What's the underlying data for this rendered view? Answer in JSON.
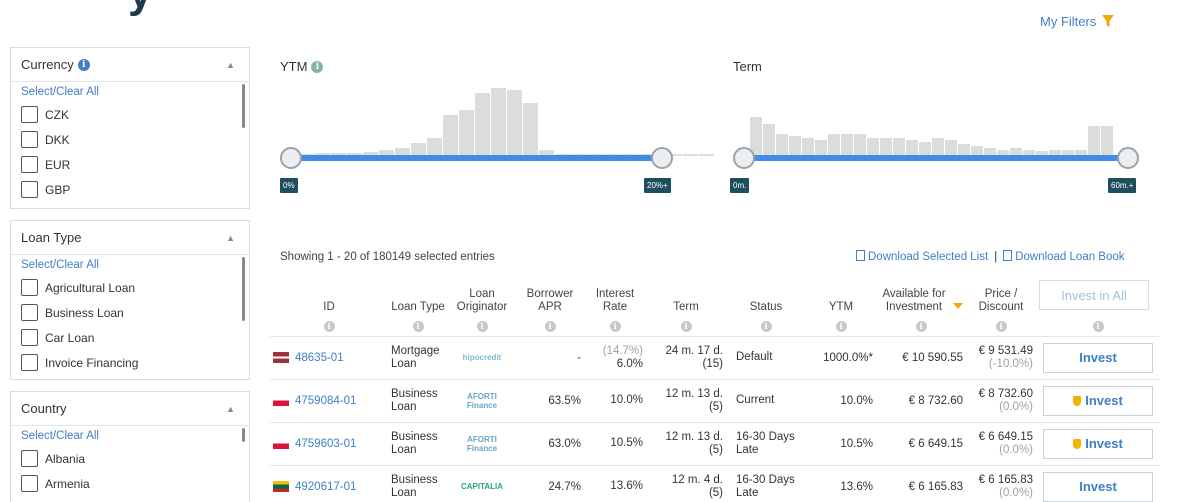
{
  "header": {
    "title_fragment": "y",
    "my_filters_label": "My Filters",
    "filter_icon": "funnel-icon",
    "accent": "#3f7fc4",
    "filter_icon_color": "#f2a900"
  },
  "sidebar": {
    "currency": {
      "title": "Currency",
      "select_all": "Select/Clear All",
      "options": [
        "CZK",
        "DKK",
        "EUR",
        "GBP"
      ]
    },
    "loan_type": {
      "title": "Loan Type",
      "select_all": "Select/Clear All",
      "options": [
        "Agricultural Loan",
        "Business Loan",
        "Car Loan",
        "Invoice Financing"
      ]
    },
    "country": {
      "title": "Country",
      "select_all": "Select/Clear All",
      "options": [
        "Albania",
        "Armenia"
      ]
    }
  },
  "sliders": {
    "ytm": {
      "label": "YTM",
      "min_tag": "0%",
      "max_tag": "20%+"
    },
    "term": {
      "label": "Term",
      "min_tag": "0m.",
      "max_tag": "60m.+"
    }
  },
  "results": {
    "showing": "Showing 1 - 20 of 180149 selected entries",
    "download_selected": "Download Selected List",
    "separator": "|",
    "download_book": "Download Loan Book",
    "invest_all": "Invest in All"
  },
  "table": {
    "headers": {
      "id": "ID",
      "loan_type": "Loan Type",
      "originator": "Loan Originator",
      "apr": "Borrower APR",
      "rate": "Interest Rate",
      "term": "Term",
      "status": "Status",
      "ytm": "YTM",
      "available": "Available for Investment",
      "price": "Price / Discount"
    },
    "rows": [
      {
        "flag": "latvia",
        "id": "48635-01",
        "loan_type": "Mortgage Loan",
        "originator": "hipocredit",
        "apr": "-",
        "rate_top": "(14.7%)",
        "rate_bottom": "6.0%",
        "term_top": "24 m. 17 d.",
        "term_bottom": "(15)",
        "status": "Default",
        "ytm": "1000.0%*",
        "available": "€ 10 590.55",
        "price": "€ 9 531.49",
        "discount": "(-10.0%)",
        "invest": "Invest",
        "shield": false
      },
      {
        "flag": "poland",
        "id": "4759084-01",
        "loan_type": "Business Loan",
        "originator": "AFORTI Finance",
        "apr": "63.5%",
        "rate_top": "",
        "rate_bottom": "10.0%",
        "term_top": "12 m. 13 d.",
        "term_bottom": "(5)",
        "status": "Current",
        "ytm": "10.0%",
        "available": "€ 8 732.60",
        "price": "€ 8 732.60",
        "discount": "(0.0%)",
        "invest": "Invest",
        "shield": true
      },
      {
        "flag": "poland",
        "id": "4759603-01",
        "loan_type": "Business Loan",
        "originator": "AFORTI Finance",
        "apr": "63.0%",
        "rate_top": "",
        "rate_bottom": "10.5%",
        "term_top": "12 m. 13 d.",
        "term_bottom": "(5)",
        "status": "16-30 Days Late",
        "ytm": "10.5%",
        "available": "€ 6 649.15",
        "price": "€ 6 649.15",
        "discount": "(0.0%)",
        "invest": "Invest",
        "shield": true
      },
      {
        "flag": "lithuania",
        "id": "4920617-01",
        "loan_type": "Business Loan",
        "originator": "CAPITALIA",
        "apr": "24.7%",
        "rate_top": "",
        "rate_bottom": "13.6%",
        "term_top": "12 m. 4 d.",
        "term_bottom": "(5)",
        "status": "16-30 Days Late",
        "ytm": "13.6%",
        "available": "€ 6 165.83",
        "price": "€ 6 165.83",
        "discount": "(0.0%)",
        "invest": "Invest",
        "shield": false
      }
    ]
  }
}
